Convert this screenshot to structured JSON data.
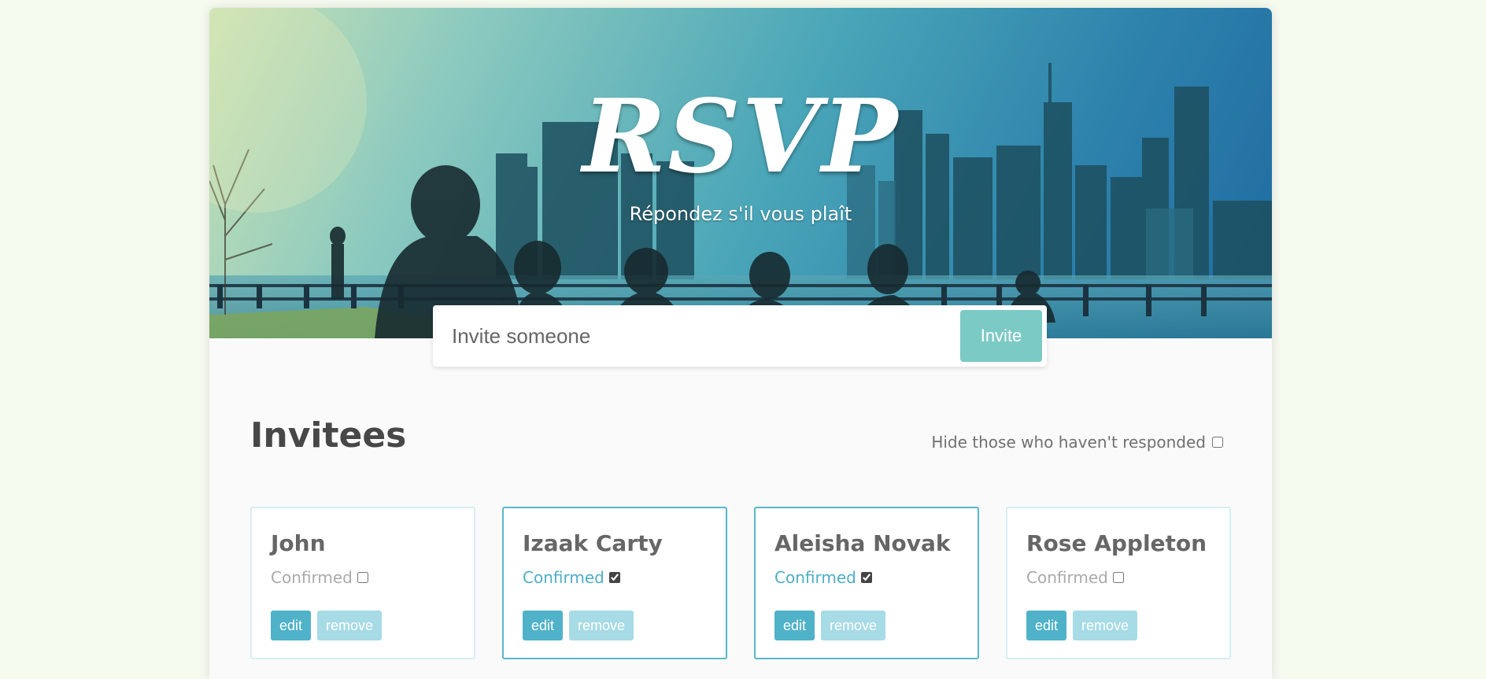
{
  "hero": {
    "title": "RSVP",
    "subtitle": "Répondez s'il vous plaît"
  },
  "invite_form": {
    "placeholder": "Invite someone",
    "button_label": "Invite"
  },
  "invitees": {
    "heading": "Invitees",
    "hide_filter_label": "Hide those who haven't responded",
    "hide_filter_checked": false,
    "cards": [
      {
        "name": "John",
        "confirmed_label": "Confirmed",
        "confirmed": false,
        "edit_label": "edit",
        "remove_label": "remove"
      },
      {
        "name": "Izaak Carty",
        "confirmed_label": "Confirmed",
        "confirmed": true,
        "edit_label": "edit",
        "remove_label": "remove"
      },
      {
        "name": "Aleisha Novak",
        "confirmed_label": "Confirmed",
        "confirmed": true,
        "edit_label": "edit",
        "remove_label": "remove"
      },
      {
        "name": "Rose Appleton",
        "confirmed_label": "Confirmed",
        "confirmed": false,
        "edit_label": "edit",
        "remove_label": "remove"
      }
    ]
  },
  "colors": {
    "accent": "#4fb2c8",
    "invite_button": "#7ccac5",
    "remove_button": "#a7dbe6",
    "confirmed_border": "#5ab7c9",
    "page_background": "#f6fbf0"
  }
}
